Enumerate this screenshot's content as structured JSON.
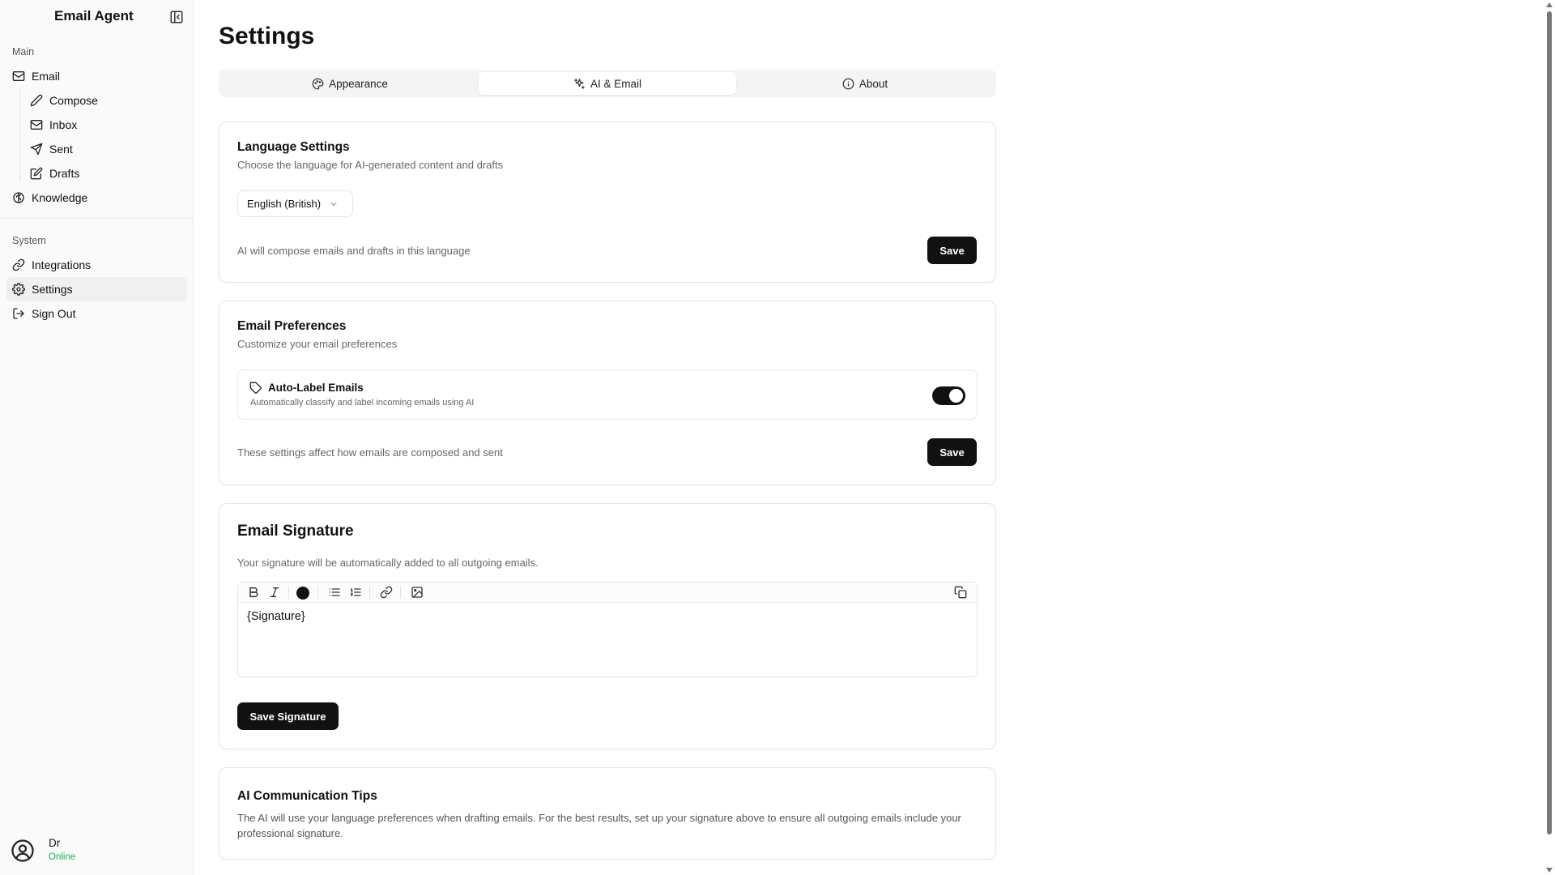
{
  "app": {
    "title": "Email Agent"
  },
  "sidebar": {
    "groups": [
      {
        "label": "Main",
        "items": [
          {
            "label": "Email",
            "icon": "mail-icon"
          },
          {
            "label": "Compose",
            "icon": "pen-icon"
          },
          {
            "label": "Inbox",
            "icon": "mail-icon"
          },
          {
            "label": "Sent",
            "icon": "send-icon"
          },
          {
            "label": "Drafts",
            "icon": "edit-icon"
          },
          {
            "label": "Knowledge",
            "icon": "brain-icon"
          }
        ]
      },
      {
        "label": "System",
        "items": [
          {
            "label": "Integrations",
            "icon": "link-icon"
          },
          {
            "label": "Settings",
            "icon": "gear-icon",
            "active": true
          },
          {
            "label": "Sign Out",
            "icon": "logout-icon"
          }
        ]
      }
    ],
    "user": {
      "name": "Dr",
      "status": "Online",
      "status_color": "#22b05a"
    }
  },
  "page": {
    "title": "Settings",
    "tabs": [
      {
        "label": "Appearance",
        "icon": "palette-icon"
      },
      {
        "label": "AI & Email",
        "icon": "sparkles-icon",
        "active": true
      },
      {
        "label": "About",
        "icon": "info-icon"
      }
    ]
  },
  "language": {
    "title": "Language Settings",
    "subtitle": "Choose the language for AI-generated content and drafts",
    "selected": "English (British)",
    "note": "AI will compose emails and drafts in this language",
    "save_label": "Save"
  },
  "preferences": {
    "title": "Email Preferences",
    "subtitle": "Customize your email preferences",
    "auto_label": {
      "title": "Auto-Label Emails",
      "description": "Automatically classify and label incoming emails using AI",
      "enabled": true
    },
    "note": "These settings affect how emails are composed and sent",
    "save_label": "Save"
  },
  "signature": {
    "title": "Email Signature",
    "subtitle": "Your signature will be automatically added to all outgoing emails.",
    "content": "{Signature}",
    "text_color": "#111111",
    "save_label": "Save Signature"
  },
  "tips": {
    "title": "AI Communication Tips",
    "text": "The AI will use your language preferences when drafting emails. For the best results, set up your signature above to ensure all outgoing emails include your professional signature."
  }
}
